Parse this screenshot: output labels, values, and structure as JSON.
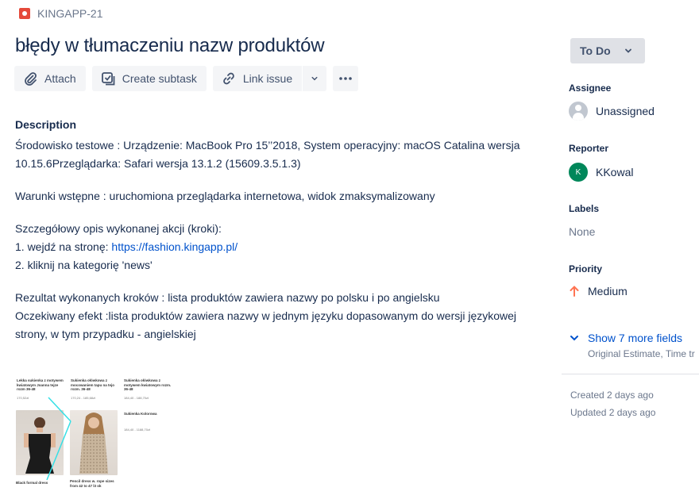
{
  "breadcrumb": {
    "issue_key": "KINGAPP-21",
    "icon": "bug-icon",
    "icon_color": "#e5493a"
  },
  "issue": {
    "title": "błędy w tłumaczeniu nazw produktów"
  },
  "toolbar": {
    "attach": "Attach",
    "create_subtask": "Create subtask",
    "link_issue": "Link issue"
  },
  "description": {
    "label": "Description",
    "p1": "Środowisko testowe : Urządzenie: MacBook Pro 15’’2018, System operacyjny: macOS Catalina wersja 10.15.6Przeglądarka: Safari wersja 13.1.2 (15609.3.5.1.3)",
    "p2": "Warunki wstępne : uruchomiona przeglądarka internetowa, widok zmaksymalizowany",
    "p3_line1": "Szczegółowy opis wykonanej akcji (kroki):",
    "p3_line2_prefix": "1. wejdź na stronę: ",
    "p3_link": "https://fashion.kingapp.pl/",
    "p3_line3": "2. kliknij na kategorię 'news'",
    "p4_line1": "Rezultat wykonanych kroków : lista produktów zawiera nazwy po polsku i po angielsku",
    "p4_line2": "Oczekiwany efekt :lista produktów zawiera nazwy w jednym języku dopasowanym do wersji językowej strony, w tym przypadku - angielskiej"
  },
  "attachment": {
    "t1": "Lekka sukienka z motywem kwiatowym Joanna tejze rozm 36-48",
    "t1p": "170,52zł",
    "t2": "Sukienka ołówkowa z mocowaniem tapu na tejo rozm. 36-48",
    "t2p": "170,24 - 185,68zł",
    "t3": "Sukienka ołówkowa z motywem kwiatowym rozm. 36-48",
    "t3p": "184,40 - 188,70zł",
    "t4": "Sukienka Kolorowa",
    "t5p": "184,40 - 1188,70zł",
    "c1": "Black formal dress",
    "c2": "Pencil dress w. rope sizes from 42 to 47 l3 ok"
  },
  "sidebar": {
    "status": "To Do",
    "assignee_label": "Assignee",
    "assignee_value": "Unassigned",
    "reporter_label": "Reporter",
    "reporter_initial": "K",
    "reporter_value": "KKowal",
    "reporter_color": "#00875a",
    "labels_label": "Labels",
    "labels_value": "None",
    "priority_label": "Priority",
    "priority_value": "Medium",
    "priority_color": "#ff7452",
    "show_more": "Show 7 more fields",
    "show_more_sub": "Original Estimate, Time tr",
    "created": "Created 2 days ago",
    "updated": "Updated 2 days ago"
  }
}
